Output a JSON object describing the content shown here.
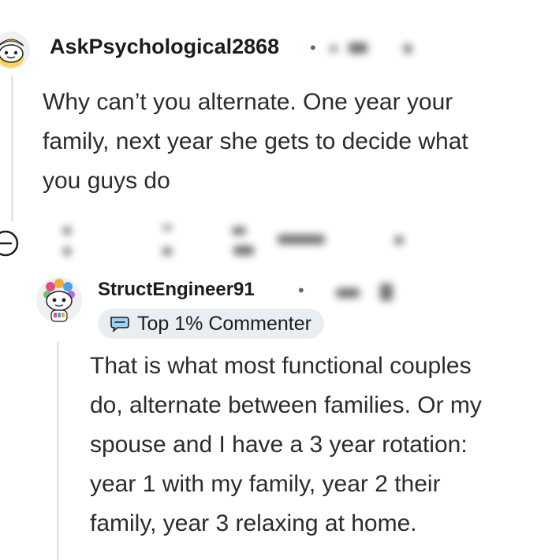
{
  "comments": [
    {
      "username": "AskPsychological2868",
      "separator": "•",
      "body": [
        "Why can’t you alternate. One year your",
        "family, next year she gets to decide what",
        "you guys do"
      ],
      "avatar_icon": "snoo-avatar-icon"
    },
    {
      "username": "StructEngineer91",
      "separator": "•",
      "badge": "Top 1% Commenter",
      "badge_icon": "commenter-badge-icon",
      "body": [
        "That is what most functional couples",
        "do, alternate between families. Or my",
        "spouse and I have a 3 year rotation:",
        "year 1 with my family, year 2 their",
        "family, year 3 relaxing at home."
      ],
      "avatar_icon": "snoo-avatar-icon"
    }
  ],
  "collapse_icon": "collapse-minus-icon",
  "colors": {
    "thread_line": "#e4e6e8",
    "badge_bg": "#e9eef2",
    "meta": "#576f76"
  }
}
